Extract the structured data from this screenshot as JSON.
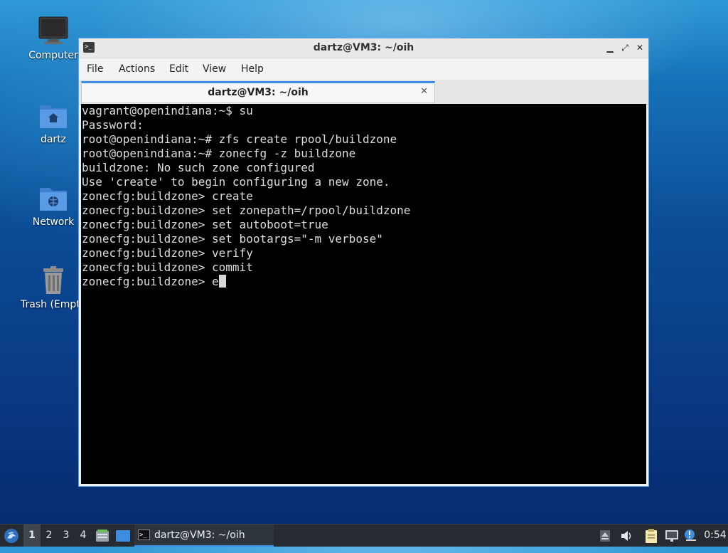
{
  "desktop": {
    "icons": [
      {
        "label": "Computer"
      },
      {
        "label": "dartz"
      },
      {
        "label": "Network"
      },
      {
        "label": "Trash (Empty)"
      }
    ]
  },
  "window": {
    "title": "dartz@VM3: ~/oih",
    "controls": {
      "minimize": "▁",
      "maximize": "⤢",
      "close": "✕"
    },
    "menu": [
      "File",
      "Actions",
      "Edit",
      "View",
      "Help"
    ],
    "tab": {
      "title": "dartz@VM3: ~/oih",
      "close": "✕"
    }
  },
  "terminal": {
    "lines": [
      "vagrant@openindiana:~$ su",
      "Password:",
      "root@openindiana:~# zfs create rpool/buildzone",
      "root@openindiana:~# zonecfg -z buildzone",
      "buildzone: No such zone configured",
      "Use 'create' to begin configuring a new zone.",
      "zonecfg:buildzone> create",
      "zonecfg:buildzone> set zonepath=/rpool/buildzone",
      "zonecfg:buildzone> set autoboot=true",
      "zonecfg:buildzone> set bootargs=\"-m verbose\"",
      "zonecfg:buildzone> verify",
      "zonecfg:buildzone> commit"
    ],
    "current_prompt": "zonecfg:buildzone> ",
    "current_input": "e"
  },
  "taskbar": {
    "workspaces": [
      "1",
      "2",
      "3",
      "4"
    ],
    "active_workspace": "1",
    "task": {
      "title": "dartz@VM3: ~/oih"
    },
    "clock": "0:54"
  },
  "colors": {
    "accent": "#3d8ee3",
    "terminal_bg": "#000000",
    "terminal_fg": "#dcdcdc",
    "taskbar_bg": "#262b31"
  }
}
